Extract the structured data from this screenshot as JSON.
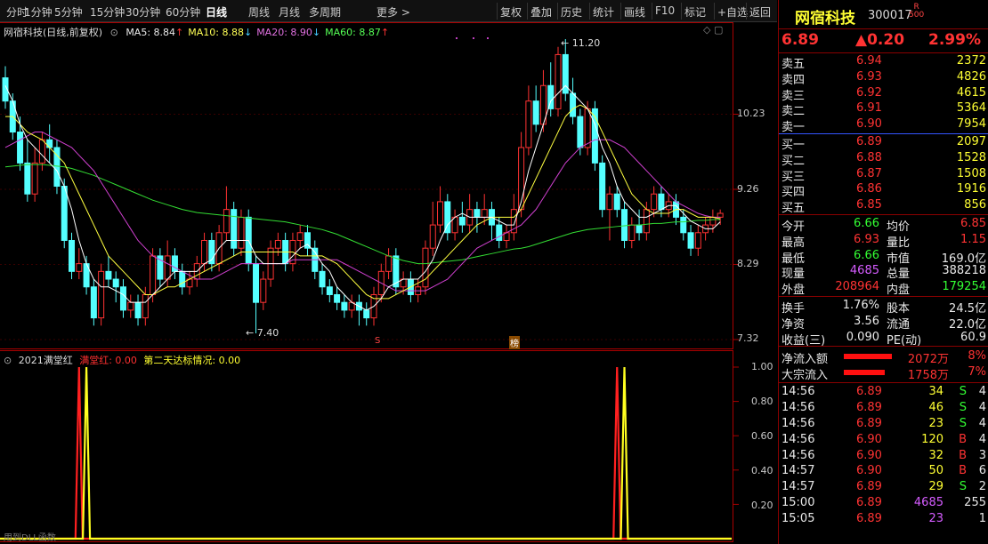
{
  "toolbar": {
    "periods": [
      "分时",
      "1分钟",
      "5分钟",
      "15分钟",
      "30分钟",
      "60分钟",
      "日线",
      "周线",
      "月线",
      "多周期",
      "更多"
    ],
    "active": "日线",
    "more_label": "更多 >",
    "actions": [
      "复权",
      "叠加",
      "历史",
      "统计",
      "画线",
      "F10",
      "标记",
      "+自选",
      "返回"
    ]
  },
  "chart": {
    "title": "网宿科技(日线,前复权)",
    "ma": [
      {
        "label": "MA5: 8.84",
        "arrow": "↑",
        "color": "#e8e8e8"
      },
      {
        "label": "MA10: 8.88",
        "arrow": "↓",
        "color": "#ffff55"
      },
      {
        "label": "MA20: 8.90",
        "arrow": "↓",
        "color": "#e070e0"
      },
      {
        "label": "MA60: 8.87",
        "arrow": "↑",
        "color": "#55ff55"
      }
    ],
    "yaxis": [
      "10.23",
      "9.26",
      "8.29",
      "7.32"
    ],
    "high_mark": "11.20",
    "low_mark": "7.40",
    "s_mark": "S",
    "bang_mark": "榜"
  },
  "sub": {
    "title": "2021满堂红",
    "v1": "满堂红: 0.00",
    "v2": "第二天达标情况: 0.00",
    "yaxis": [
      "1.00",
      "0.80",
      "0.60",
      "0.40",
      "0.20"
    ],
    "footer": "用到DLL函数"
  },
  "quote": {
    "name": "网宿科技",
    "code": "300017",
    "r_mark": "R",
    "index_tag": "500",
    "price": "6.89",
    "change": "▲0.20",
    "pct": "2.99%",
    "asks": [
      {
        "l": "卖五",
        "p": "6.94",
        "v": "2372"
      },
      {
        "l": "卖四",
        "p": "6.93",
        "v": "4826"
      },
      {
        "l": "卖三",
        "p": "6.92",
        "v": "4615"
      },
      {
        "l": "卖二",
        "p": "6.91",
        "v": "5364"
      },
      {
        "l": "卖一",
        "p": "6.90",
        "v": "7954"
      }
    ],
    "bids": [
      {
        "l": "买一",
        "p": "6.89",
        "v": "2097"
      },
      {
        "l": "买二",
        "p": "6.88",
        "v": "1528"
      },
      {
        "l": "买三",
        "p": "6.87",
        "v": "1508"
      },
      {
        "l": "买四",
        "p": "6.86",
        "v": "1916"
      },
      {
        "l": "买五",
        "p": "6.85",
        "v": "856"
      }
    ],
    "stats": [
      {
        "l1": "今开",
        "v1": "6.66",
        "l2": "均价",
        "v2": "6.85"
      },
      {
        "l1": "最高",
        "v1": "6.93",
        "l2": "量比",
        "v2": "1.15"
      },
      {
        "l1": "最低",
        "v1": "6.66",
        "l2": "市值",
        "v2": "169.0亿"
      },
      {
        "l1": "现量",
        "v1": "4685",
        "l2": "总量",
        "v2": "388218"
      },
      {
        "l1": "外盘",
        "v1": "208964",
        "l2": "内盘",
        "v2": "179254"
      }
    ],
    "stats2": [
      {
        "l1": "换手",
        "v1": "1.76%",
        "l2": "股本",
        "v2": "24.5亿"
      },
      {
        "l1": "净资",
        "v1": "3.56",
        "l2": "流通",
        "v2": "22.0亿"
      },
      {
        "l1": "收益(三)",
        "v1": "0.090",
        "l2": "PE(动)",
        "v2": "60.9"
      }
    ],
    "flows": [
      {
        "l": "净流入额",
        "v": "2072万",
        "p": "8%",
        "bar": 1.0
      },
      {
        "l": "大宗流入",
        "v": "1758万",
        "p": "7%",
        "bar": 0.86
      }
    ],
    "ticks": [
      {
        "t": "14:56",
        "p": "6.89",
        "v": "34",
        "d": "S",
        "n": "4"
      },
      {
        "t": "14:56",
        "p": "6.89",
        "v": "46",
        "d": "S",
        "n": "4"
      },
      {
        "t": "14:56",
        "p": "6.89",
        "v": "23",
        "d": "S",
        "n": "4"
      },
      {
        "t": "14:56",
        "p": "6.90",
        "v": "120",
        "d": "B",
        "n": "4"
      },
      {
        "t": "14:56",
        "p": "6.90",
        "v": "32",
        "d": "B",
        "n": "3"
      },
      {
        "t": "14:57",
        "p": "6.90",
        "v": "50",
        "d": "B",
        "n": "6"
      },
      {
        "t": "14:57",
        "p": "6.89",
        "v": "29",
        "d": "S",
        "n": "2"
      },
      {
        "t": "15:00",
        "p": "6.89",
        "v": "4685",
        "d": "",
        "n": "255"
      },
      {
        "t": "15:05",
        "p": "6.89",
        "v": "23",
        "d": "",
        "n": "1"
      }
    ]
  },
  "chart_data": {
    "type": "candlestick",
    "ylim": [
      7.32,
      11.2
    ],
    "yticks": [
      10.23,
      9.26,
      8.29,
      7.32
    ],
    "candles": [
      [
        10.7,
        10.4,
        10.85,
        10.3
      ],
      [
        10.4,
        10.0,
        10.5,
        9.9
      ],
      [
        10.0,
        9.6,
        10.2,
        9.5
      ],
      [
        9.6,
        9.2,
        9.9,
        9.1
      ],
      [
        9.2,
        9.6,
        9.8,
        9.1
      ],
      [
        9.6,
        9.9,
        10.0,
        9.5
      ],
      [
        9.9,
        9.8,
        10.1,
        9.6
      ],
      [
        9.8,
        9.3,
        9.9,
        9.2
      ],
      [
        9.3,
        8.6,
        9.4,
        8.5
      ],
      [
        8.6,
        8.2,
        8.7,
        8.1
      ],
      [
        8.2,
        8.3,
        8.5,
        8.1
      ],
      [
        8.3,
        8.0,
        8.4,
        7.9
      ],
      [
        8.0,
        7.6,
        8.1,
        7.5
      ],
      [
        7.6,
        8.2,
        8.3,
        7.5
      ],
      [
        8.2,
        8.1,
        8.4,
        8.0
      ],
      [
        8.1,
        8.0,
        8.2,
        7.8
      ],
      [
        8.0,
        7.7,
        8.1,
        7.6
      ],
      [
        7.7,
        7.8,
        7.9,
        7.6
      ],
      [
        7.8,
        7.6,
        7.9,
        7.5
      ],
      [
        7.6,
        7.9,
        8.0,
        7.5
      ],
      [
        7.9,
        8.4,
        8.5,
        7.8
      ],
      [
        8.4,
        8.1,
        8.5,
        8.0
      ],
      [
        8.1,
        8.4,
        8.6,
        8.0
      ],
      [
        8.4,
        8.2,
        8.5,
        8.1
      ],
      [
        8.2,
        8.0,
        8.3,
        7.9
      ],
      [
        8.0,
        8.1,
        8.2,
        7.9
      ],
      [
        8.1,
        8.3,
        8.4,
        8.0
      ],
      [
        8.3,
        8.6,
        8.7,
        8.2
      ],
      [
        8.6,
        8.3,
        8.7,
        8.2
      ],
      [
        8.3,
        8.7,
        8.8,
        8.2
      ],
      [
        8.7,
        9.0,
        9.3,
        8.6
      ],
      [
        9.0,
        8.5,
        9.1,
        8.4
      ],
      [
        8.5,
        8.9,
        9.0,
        8.4
      ],
      [
        8.9,
        8.3,
        9.0,
        8.2
      ],
      [
        8.3,
        7.8,
        8.4,
        7.4
      ],
      [
        7.8,
        8.1,
        8.2,
        7.7
      ],
      [
        8.1,
        8.5,
        8.6,
        8.0
      ],
      [
        8.5,
        8.6,
        8.7,
        8.4
      ],
      [
        8.6,
        8.3,
        8.7,
        8.2
      ],
      [
        8.3,
        8.6,
        8.7,
        8.2
      ],
      [
        8.6,
        8.7,
        8.8,
        8.5
      ],
      [
        8.7,
        8.5,
        8.8,
        8.4
      ],
      [
        8.5,
        8.2,
        8.6,
        8.1
      ],
      [
        8.2,
        8.0,
        8.3,
        7.9
      ],
      [
        8.0,
        7.9,
        8.1,
        7.8
      ],
      [
        7.9,
        7.8,
        8.0,
        7.7
      ],
      [
        7.8,
        7.7,
        7.9,
        7.6
      ],
      [
        7.7,
        7.8,
        7.9,
        7.6
      ],
      [
        7.8,
        7.7,
        7.9,
        7.5
      ],
      [
        7.7,
        7.6,
        7.8,
        7.5
      ],
      [
        7.6,
        7.9,
        8.0,
        7.5
      ],
      [
        7.9,
        8.2,
        8.3,
        7.8
      ],
      [
        8.2,
        8.4,
        8.5,
        8.1
      ],
      [
        8.4,
        8.0,
        8.5,
        7.9
      ],
      [
        8.0,
        8.1,
        8.2,
        7.9
      ],
      [
        8.1,
        7.9,
        8.2,
        7.8
      ],
      [
        7.9,
        8.0,
        8.1,
        7.8
      ],
      [
        8.0,
        8.5,
        8.6,
        7.9
      ],
      [
        8.5,
        8.8,
        9.1,
        8.4
      ],
      [
        8.8,
        9.1,
        9.3,
        8.7
      ],
      [
        9.1,
        8.7,
        9.2,
        8.6
      ],
      [
        8.7,
        8.9,
        9.0,
        8.6
      ],
      [
        8.9,
        8.8,
        9.1,
        8.7
      ],
      [
        8.8,
        9.0,
        9.2,
        8.7
      ],
      [
        9.0,
        8.9,
        9.1,
        8.7
      ],
      [
        8.9,
        9.0,
        9.2,
        8.8
      ],
      [
        9.0,
        8.8,
        9.1,
        8.6
      ],
      [
        8.8,
        8.6,
        8.9,
        8.5
      ],
      [
        8.6,
        8.7,
        8.8,
        8.5
      ],
      [
        8.7,
        9.0,
        9.2,
        8.6
      ],
      [
        9.0,
        9.8,
        10.0,
        8.9
      ],
      [
        9.8,
        10.4,
        10.6,
        9.7
      ],
      [
        10.4,
        10.1,
        10.6,
        10.0
      ],
      [
        10.1,
        10.6,
        10.8,
        10.0
      ],
      [
        10.6,
        10.3,
        10.9,
        10.2
      ],
      [
        10.3,
        11.0,
        11.1,
        10.2
      ],
      [
        11.0,
        10.5,
        11.2,
        10.4
      ],
      [
        10.5,
        10.2,
        10.7,
        10.1
      ],
      [
        10.2,
        9.8,
        10.3,
        9.7
      ],
      [
        9.8,
        10.3,
        10.4,
        9.7
      ],
      [
        10.3,
        9.6,
        10.4,
        9.5
      ],
      [
        9.6,
        9.0,
        9.7,
        8.9
      ],
      [
        9.0,
        9.2,
        9.3,
        8.6
      ],
      [
        9.2,
        9.0,
        9.3,
        8.9
      ],
      [
        9.0,
        8.6,
        9.1,
        8.5
      ],
      [
        8.6,
        8.8,
        8.9,
        8.5
      ],
      [
        8.8,
        8.7,
        9.0,
        8.6
      ],
      [
        8.7,
        9.0,
        9.1,
        8.6
      ],
      [
        9.0,
        9.2,
        9.3,
        8.9
      ],
      [
        9.2,
        9.0,
        9.3,
        8.9
      ],
      [
        9.0,
        9.1,
        9.2,
        8.9
      ],
      [
        9.1,
        8.9,
        9.2,
        8.8
      ],
      [
        8.9,
        8.7,
        9.0,
        8.6
      ],
      [
        8.7,
        8.5,
        8.8,
        8.4
      ],
      [
        8.5,
        8.7,
        8.8,
        8.4
      ],
      [
        8.7,
        8.8,
        8.9,
        8.6
      ],
      [
        8.8,
        8.9,
        9.0,
        8.7
      ],
      [
        8.9,
        8.95,
        9.0,
        8.8
      ]
    ],
    "ma5": [
      10.6,
      10.4,
      10.1,
      9.9,
      9.8,
      9.7,
      9.6,
      9.5,
      9.3,
      9.0,
      8.6,
      8.3,
      8.1,
      8.0,
      8.0,
      7.95,
      7.9,
      7.8,
      7.8,
      7.8,
      7.9,
      8.0,
      8.1,
      8.2,
      8.2,
      8.2,
      8.2,
      8.3,
      8.35,
      8.5,
      8.6,
      8.6,
      8.6,
      8.6,
      8.4,
      8.3,
      8.3,
      8.3,
      8.3,
      8.4,
      8.5,
      8.55,
      8.45,
      8.3,
      8.2,
      8.0,
      7.9,
      7.8,
      7.75,
      7.7,
      7.75,
      7.85,
      8.0,
      8.05,
      8.1,
      8.1,
      8.1,
      8.2,
      8.35,
      8.6,
      8.8,
      8.9,
      8.95,
      8.9,
      8.9,
      8.9,
      8.9,
      8.85,
      8.8,
      8.8,
      9.1,
      9.5,
      9.8,
      10.1,
      10.4,
      10.5,
      10.6,
      10.5,
      10.4,
      10.3,
      10.1,
      9.8,
      9.6,
      9.3,
      9.1,
      9.0,
      8.9,
      8.9,
      8.95,
      9.0,
      9.05,
      9.05,
      8.95,
      8.85,
      8.8,
      8.75,
      8.75,
      8.84
    ],
    "ma10": [
      10.2,
      10.2,
      10.1,
      10.0,
      9.95,
      9.9,
      9.8,
      9.7,
      9.6,
      9.4,
      9.2,
      9.0,
      8.8,
      8.6,
      8.4,
      8.3,
      8.2,
      8.1,
      8.0,
      7.9,
      7.9,
      7.95,
      8.0,
      8.0,
      8.05,
      8.1,
      8.15,
      8.2,
      8.25,
      8.3,
      8.35,
      8.4,
      8.45,
      8.45,
      8.45,
      8.45,
      8.45,
      8.45,
      8.45,
      8.45,
      8.4,
      8.4,
      8.4,
      8.4,
      8.35,
      8.3,
      8.2,
      8.1,
      8.0,
      7.9,
      7.85,
      7.85,
      7.85,
      7.9,
      7.95,
      8.0,
      8.05,
      8.1,
      8.2,
      8.3,
      8.4,
      8.5,
      8.6,
      8.7,
      8.8,
      8.85,
      8.9,
      8.9,
      8.9,
      8.9,
      9.0,
      9.2,
      9.4,
      9.6,
      9.8,
      10.0,
      10.2,
      10.3,
      10.35,
      10.3,
      10.2,
      10.0,
      9.8,
      9.6,
      9.4,
      9.2,
      9.1,
      9.0,
      8.95,
      8.95,
      8.95,
      9.0,
      9.0,
      8.95,
      8.9,
      8.9,
      8.9,
      8.88
    ],
    "ma20": [
      9.8,
      9.85,
      9.9,
      9.95,
      10.0,
      10.0,
      9.95,
      9.9,
      9.85,
      9.8,
      9.7,
      9.6,
      9.5,
      9.35,
      9.2,
      9.05,
      8.9,
      8.75,
      8.6,
      8.5,
      8.4,
      8.35,
      8.3,
      8.25,
      8.2,
      8.15,
      8.1,
      8.1,
      8.1,
      8.15,
      8.2,
      8.25,
      8.3,
      8.3,
      8.3,
      8.3,
      8.3,
      8.3,
      8.3,
      8.35,
      8.35,
      8.35,
      8.35,
      8.35,
      8.35,
      8.35,
      8.3,
      8.25,
      8.2,
      8.15,
      8.1,
      8.05,
      8.0,
      7.95,
      7.95,
      7.95,
      7.95,
      7.95,
      8.0,
      8.05,
      8.1,
      8.2,
      8.3,
      8.4,
      8.5,
      8.55,
      8.6,
      8.65,
      8.7,
      8.75,
      8.8,
      8.9,
      9.0,
      9.15,
      9.3,
      9.45,
      9.6,
      9.7,
      9.8,
      9.85,
      9.9,
      9.9,
      9.9,
      9.85,
      9.8,
      9.7,
      9.6,
      9.5,
      9.4,
      9.3,
      9.2,
      9.1,
      9.05,
      9.0,
      8.95,
      8.92,
      8.9,
      8.9
    ],
    "ma60": [
      9.55,
      9.56,
      9.57,
      9.58,
      9.58,
      9.58,
      9.57,
      9.56,
      9.55,
      9.53,
      9.5,
      9.47,
      9.44,
      9.4,
      9.36,
      9.32,
      9.28,
      9.24,
      9.2,
      9.16,
      9.12,
      9.09,
      9.06,
      9.03,
      9.0,
      8.98,
      8.96,
      8.95,
      8.94,
      8.93,
      8.92,
      8.91,
      8.9,
      8.89,
      8.88,
      8.87,
      8.86,
      8.85,
      8.84,
      8.82,
      8.8,
      8.78,
      8.76,
      8.74,
      8.71,
      8.68,
      8.64,
      8.6,
      8.56,
      8.52,
      8.48,
      8.44,
      8.4,
      8.37,
      8.34,
      8.32,
      8.3,
      8.3,
      8.31,
      8.32,
      8.33,
      8.34,
      8.35,
      8.37,
      8.39,
      8.41,
      8.43,
      8.45,
      8.47,
      8.49,
      8.5,
      8.52,
      8.55,
      8.58,
      8.61,
      8.64,
      8.67,
      8.7,
      8.72,
      8.74,
      8.75,
      8.76,
      8.77,
      8.78,
      8.79,
      8.8,
      8.8,
      8.81,
      8.82,
      8.82,
      8.83,
      8.84,
      8.84,
      8.85,
      8.86,
      8.86,
      8.87,
      8.87
    ],
    "signals": [
      {
        "name": "满堂红",
        "color": "#ff2020",
        "index": [
          10,
          83
        ]
      },
      {
        "name": "第二天达标情况",
        "color": "#ffff20",
        "index": [
          11,
          84
        ]
      }
    ]
  }
}
